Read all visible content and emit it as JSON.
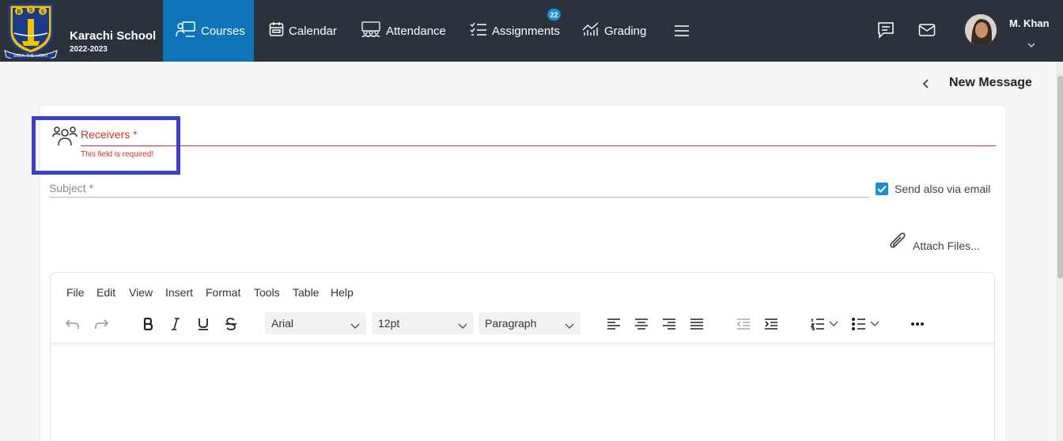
{
  "school": {
    "name": "Karachi School",
    "year": "2022-2023",
    "logo_letters": "BSS",
    "logo_motto": "SEEK THE LIGHT"
  },
  "nav": {
    "items": [
      {
        "label": "Courses",
        "icon": "courses-icon",
        "active": true
      },
      {
        "label": "Calendar",
        "icon": "calendar-icon"
      },
      {
        "label": "Attendance",
        "icon": "attendance-icon"
      },
      {
        "label": "Assignments",
        "icon": "assignments-icon",
        "badge": "22"
      },
      {
        "label": "Grading",
        "icon": "grading-icon"
      }
    ],
    "menu_icon": "hamburger-icon"
  },
  "header_icons": [
    "chat-icon",
    "mail-icon"
  ],
  "user": {
    "name": "M. Khan"
  },
  "page": {
    "title": "New Message"
  },
  "form": {
    "receivers_label": "Receivers *",
    "receivers_error": "This field is required!",
    "subject_placeholder": "Subject *",
    "subject_value": "",
    "send_email_label": "Send also via email",
    "send_email_checked": true,
    "attach_label": "Attach Files..."
  },
  "editor": {
    "menu": [
      "File",
      "Edit",
      "View",
      "Insert",
      "Format",
      "Tools",
      "Table",
      "Help"
    ],
    "font": "Arial",
    "size": "12pt",
    "block": "Paragraph"
  },
  "colors": {
    "nav_bg": "#2b323b",
    "accent": "#0e75b8",
    "error": "#d93025",
    "highlight": "#3c3fc7"
  }
}
